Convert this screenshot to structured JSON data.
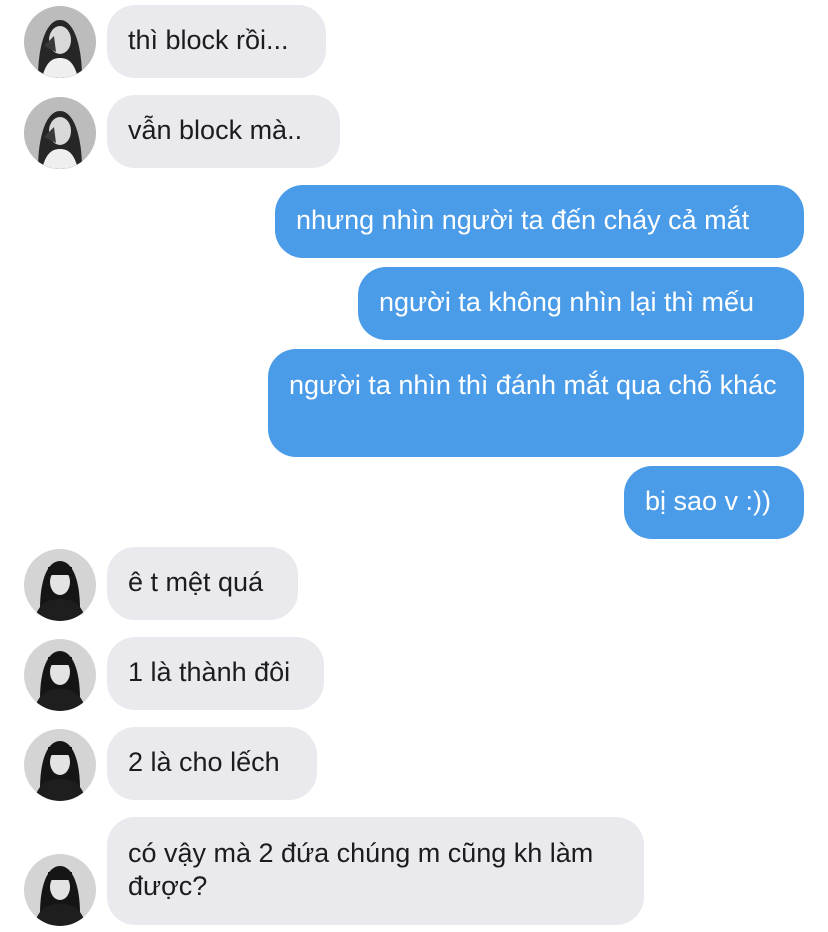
{
  "messages": [
    {
      "from": "them",
      "text": "thì block rồi..."
    },
    {
      "from": "them",
      "text": "vẫn block mà.."
    },
    {
      "from": "me",
      "text": "nhưng nhìn người ta đến cháy cả mắt"
    },
    {
      "from": "me",
      "text": "người ta không nhìn lại thì mếu"
    },
    {
      "from": "me",
      "text": "người ta nhìn thì đánh mắt qua chỗ khác"
    },
    {
      "from": "me",
      "text": "bị sao v :))"
    },
    {
      "from": "them",
      "text": "ê t mệt quá"
    },
    {
      "from": "them",
      "text": "1 là thành đôi"
    },
    {
      "from": "them",
      "text": "2 là cho lếch"
    },
    {
      "from": "them",
      "text": "có vậy mà 2 đứa chúng m cũng kh làm được?"
    }
  ],
  "avatars": [
    {
      "icon": "user-avatar-photo-icon"
    },
    {
      "icon": "user-avatar-photo-icon"
    },
    {
      "icon": "user-avatar-photo-icon"
    },
    {
      "icon": "user-avatar-photo-icon"
    },
    {
      "icon": "user-avatar-photo-icon"
    },
    {
      "icon": "user-avatar-photo-icon"
    }
  ],
  "colors": {
    "incoming_bubble": "#e9e9ee",
    "outgoing_bubble": "#4a9be8",
    "incoming_text": "#1c1c1e",
    "outgoing_text": "#ffffff"
  }
}
